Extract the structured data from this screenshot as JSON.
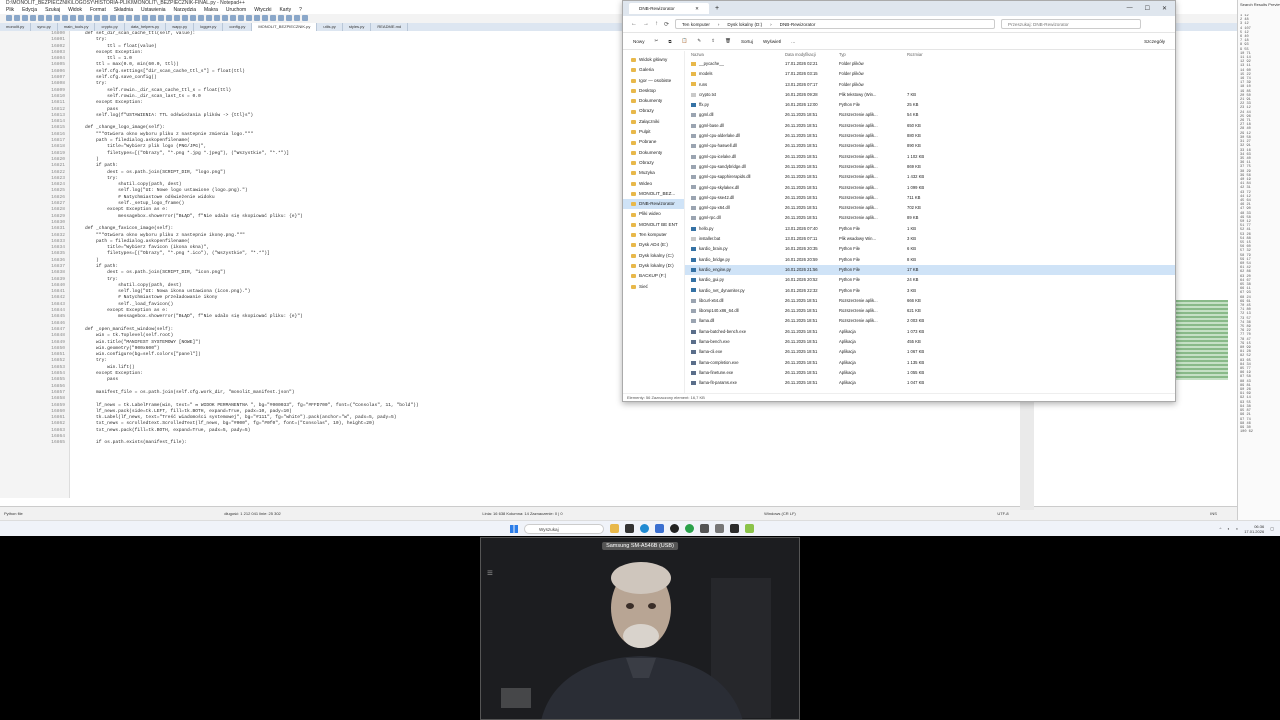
{
  "editor": {
    "title": "D:\\MONOLIT_BEZPIECZNIK\\LOGOSY\\HISTORIA-PLIKI\\MONOLIT\\_BEZPIECZNIK-FINAL.py - Notepad++",
    "menu": [
      "Plik",
      "Edycja",
      "Szukaj",
      "Widok",
      "Format",
      "Składnia",
      "Ustawienia",
      "Narzędzia",
      "Makra",
      "Uruchom",
      "Wtyczki",
      "Karty",
      "?"
    ],
    "tabs": [
      "monolit.py",
      "sync.py",
      "main_tools.py",
      "crypto.py",
      "data_helpers.py",
      "wapp.py",
      "logger.py",
      "config.py",
      "MONOLIT_BEZPIECZNIK.py",
      "utils.py",
      "styles.py",
      "README.md"
    ],
    "active_tab_index": 8,
    "line_start": 16800,
    "code_lines": [
      "    def set_dir_scan_cache_ttl(self, value):",
      "        try:",
      "            ttl = float(value)",
      "        except Exception:",
      "            ttl = 1.0",
      "        ttl = max(0.0, min(60.0, ttl))",
      "        self.cfg.settings[\"dir_scan_cache_ttl_s\"] = float(ttl)",
      "        self.cfg.save_config()",
      "        try:",
      "            self.rowin._dir_scan_cache_ttl_s = float(ttl)",
      "            self.rowin._dir_scan_last_ts = 0.0",
      "        except Exception:",
      "            pass",
      "        self.log(f\"USTAWIENIA: TTL odświeżania plików -> {ttl}s\")",
      "",
      "    def _change_logo_image(self):",
      "        \"\"\"Otwiera okno wyboru pliku z nastepnie zmienia logo.\"\"\"",
      "        path = filedialog.askopenfilename(",
      "            title=\"Wybierz plik logo (PNG/JPG)\",",
      "            filetypes=[(\"Obrazy\", \"*.png *.jpg *.jpeg\"), (\"Wszystkie\", \"*.*\")]",
      "        )",
      "        if path:",
      "            dest = os.path.join(SCRIPT_DIR, \"logo.png\")",
      "            try:",
      "                shutil.copy(path, dest)",
      "                self.log(\"UI: Nowe logo ustawione (logo.png).\")",
      "                # Natychmiastowe odświeżenie widoku",
      "                self._setup_logo_frame()",
      "            except Exception as e:",
      "                messagebox.showerror(\"BŁĄD\", f\"Nie udało się skopiować pliku: {e}\")",
      "",
      "    def _change_favicon_image(self):",
      "        \"\"\"Otwiera okno wyboru pliku z nastepnie ikonę.png.\"\"\"",
      "        path = filedialog.askopenfilename(",
      "            title=\"Wybierz favicon (ikona okna)\",",
      "            filetypes=[(\"Obrazy\", \"*.png *.ico\"), (\"Wszystkie\", \"*.*\")]",
      "        )",
      "        if path:",
      "            dest = os.path.join(SCRIPT_DIR, \"icon.png\")",
      "            try:",
      "                shutil.copy(path, dest)",
      "                self.log(\"UI: Nowa ikona ustawiona (icon.png).\")",
      "                # Natychmiastowe przeładowanie ikony",
      "                self._load_favicon()",
      "            except Exception as e:",
      "                messagebox.showerror(\"BŁĄD\", f\"Nie udało się skopiować pliku: {e}\")",
      "",
      "    def _open_manifest_window(self):",
      "        win = tk.Toplevel(self.root)",
      "        win.title(\"MANIFEST SYSTEMOWY [NOWE]\")",
      "        win.geometry(\"900x600\")",
      "        win.configure(bg=self.colors[\"panel\"])",
      "        try:",
      "            win.lift()",
      "        except Exception:",
      "            pass",
      "",
      "        manifest_file = os.path.join(self.cfg.work_dir, \"monolit_manifest.json\")",
      "",
      "        lf_news = tk.LabelFrame(win, text=\" ✉ WIDOK PERMANENTNA \", bg=\"#000033\", fg=\"#FFD700\", font=(\"Consolas\", 11, \"bold\"))",
      "        lf_news.pack(side=tk.LEFT, fill=tk.BOTH, expand=True, padx=10, pady=10)",
      "        tk.Label(lf_news, text=\"Treść wiadomości systemowej\", bg=\"#111\", fg=\"white\").pack(anchor=\"w\", padx=5, pady=5)",
      "        txt_news = scrolledtext.ScrolledText(lf_news, bg=\"#000\", fg=\"#0f0\", font=(\"Consolas\", 10), height=20)",
      "        txt_news.pack(fill=tk.BOTH, expand=True, padx=5, pady=5)",
      "",
      "        if os.path.exists(manifest_file):"
    ],
    "status": {
      "file_type": "Python file",
      "length": "długość: 1 212 041   linie: 25 302",
      "position": "Linia: 16 638   Kolumna: 14   Zaznaczenie: 0 | 0",
      "eol": "Windows (CR LF)",
      "encoding": "UTF-8",
      "mode": "INS"
    }
  },
  "side_panel": {
    "title": "Search Results Preview",
    "lines": [
      "1 12",
      "2 48",
      "3 12",
      "4 107",
      "5 12",
      "6 40",
      "7 18",
      "8 93",
      "9 55",
      "10 71",
      "11 14",
      "12 92",
      "13 11",
      "14 60",
      "15 22",
      "16 74",
      "17 39",
      "18 10",
      "19 85",
      "20 50",
      "21 91",
      "22 33",
      "23 12",
      "24 44",
      "25 96",
      "26 71",
      "27 18",
      "28 40",
      "29 12",
      "30 58",
      "31 27",
      "32 91",
      "33 16",
      "34 63",
      "35 40",
      "36 11",
      "37 75",
      "38 29",
      "39 56",
      "40 19",
      "41 84",
      "42 31",
      "43 72",
      "44 12",
      "45 64",
      "46 21",
      "47 90",
      "48 33",
      "49 58",
      "50 12",
      "51 77",
      "52 41",
      "53 26",
      "54 88",
      "55 15",
      "56 60",
      "57 32",
      "58 79",
      "59 17",
      "60 54",
      "61 42",
      "62 86",
      "63 20",
      "64 67",
      "65 38",
      "66 11",
      "67 93",
      "68 24",
      "69 61",
      "70 45",
      "71 80",
      "72 13",
      "73 57",
      "74 36",
      "75 89",
      "76 22",
      "77 70",
      "78 47",
      "79 15",
      "80 99",
      "81 28",
      "82 52",
      "83 65",
      "84 34",
      "85 77",
      "86 19",
      "87 58",
      "88 43",
      "89 81",
      "90 26",
      "91 69",
      "92 14",
      "93 55",
      "94 38",
      "95 87",
      "96 21",
      "97 74",
      "98 46",
      "99 30",
      "100 62"
    ]
  },
  "explorer": {
    "tab_title": "DNB-Rewizorator",
    "address": [
      "Ten komputer",
      "Dysk lokalny (D:)",
      "DNB-Rewizorator"
    ],
    "search_placeholder": "Przeszukaj: DNB-Rewizorator",
    "commands": [
      "Nowy",
      "Sortuj",
      "Wyświetl",
      "Szczegóły"
    ],
    "columns": [
      "Nazwa",
      "Data modyfikacji",
      "Typ",
      "Rozmiar"
    ],
    "nav": [
      {
        "label": "Widok główny"
      },
      {
        "label": "Galeria"
      },
      {
        "label": "Igor — osobiste"
      },
      {
        "label": "Desktop"
      },
      {
        "label": "Dokumenty"
      },
      {
        "label": "Obrazy"
      },
      {
        "label": "Załączniki"
      },
      {
        "label": "Pulpit"
      },
      {
        "label": "Pobrane"
      },
      {
        "label": "Dokumenty"
      },
      {
        "label": "Obrazy"
      },
      {
        "label": "Muzyka"
      },
      {
        "label": "Wideo"
      },
      {
        "label": "MONOLIT_BEZ..."
      },
      {
        "label": "DNB-Rewizorator",
        "selected": true
      },
      {
        "label": "Pliki wideo"
      },
      {
        "label": "MONOLIT BE ENT"
      },
      {
        "label": "Ten komputer"
      },
      {
        "label": "Dysk AD4 (E:)"
      },
      {
        "label": "Dysk lokalny (C:)"
      },
      {
        "label": "Dysk lokalny (D:)"
      },
      {
        "label": "BACKUP (F:)"
      },
      {
        "label": "Sieć"
      }
    ],
    "files": [
      {
        "name": "__pycache__",
        "date": "17.01.2026 02:21",
        "type": "Folder plików",
        "size": ""
      },
      {
        "name": "models",
        "date": "17.01.2026 03:15",
        "type": "Folder plików",
        "size": ""
      },
      {
        "name": "runs",
        "date": "13.01.2026 07:17",
        "type": "Folder plików",
        "size": ""
      },
      {
        "name": "crypto.txt",
        "date": "16.01.2026 09:28",
        "type": "Plik tekstowy (Win...",
        "size": "7 KB"
      },
      {
        "name": "ffx.py",
        "date": "16.01.2026 12:00",
        "type": "Python File",
        "size": "25 KB"
      },
      {
        "name": "ggml.dll",
        "date": "26.11.2025 18:51",
        "type": "Rozszerzenie aplik...",
        "size": "54 KB"
      },
      {
        "name": "ggml-base.dll",
        "date": "26.11.2025 18:51",
        "type": "Rozszerzenie aplik...",
        "size": "650 KB"
      },
      {
        "name": "ggml-cpu-alderlake.dll",
        "date": "26.11.2025 18:51",
        "type": "Rozszerzenie aplik...",
        "size": "880 KB"
      },
      {
        "name": "ggml-cpu-haswell.dll",
        "date": "26.11.2025 18:51",
        "type": "Rozszerzenie aplik...",
        "size": "890 KB"
      },
      {
        "name": "ggml-cpu-icelake.dll",
        "date": "26.11.2025 18:51",
        "type": "Rozszerzenie aplik...",
        "size": "1 102 KB"
      },
      {
        "name": "ggml-cpu-sandybridge.dll",
        "date": "26.11.2025 18:51",
        "type": "Rozszerzenie aplik...",
        "size": "869 KB"
      },
      {
        "name": "ggml-cpu-sapphirerapids.dll",
        "date": "26.11.2025 18:51",
        "type": "Rozszerzenie aplik...",
        "size": "1 432 KB"
      },
      {
        "name": "ggml-cpu-skylakex.dll",
        "date": "26.11.2025 18:51",
        "type": "Rozszerzenie aplik...",
        "size": "1 099 KB"
      },
      {
        "name": "ggml-cpu-sse42.dll",
        "date": "26.11.2025 18:51",
        "type": "Rozszerzenie aplik...",
        "size": "711 KB"
      },
      {
        "name": "ggml-cpu-x64.dll",
        "date": "26.11.2025 18:51",
        "type": "Rozszerzenie aplik...",
        "size": "702 KB"
      },
      {
        "name": "ggml-rpc.dll",
        "date": "26.11.2025 18:51",
        "type": "Rozszerzenie aplik...",
        "size": "89 KB"
      },
      {
        "name": "hello.py",
        "date": "13.01.2026 07:40",
        "type": "Python File",
        "size": "1 KB"
      },
      {
        "name": "installer.bat",
        "date": "13.01.2026 07:11",
        "type": "Plik wsadowy Win...",
        "size": "3 KB"
      },
      {
        "name": "kardio_brain.py",
        "date": "16.01.2026 20:35",
        "type": "Python File",
        "size": "6 KB"
      },
      {
        "name": "kardio_bridge.py",
        "date": "16.01.2026 20:59",
        "type": "Python File",
        "size": "8 KB"
      },
      {
        "name": "kardio_engine.py",
        "date": "16.01.2026 21:56",
        "type": "Python File",
        "size": "17 KB",
        "selected": true
      },
      {
        "name": "kardio_gui.py",
        "date": "16.01.2026 20:52",
        "type": "Python File",
        "size": "24 KB"
      },
      {
        "name": "kardio_net_dynamiter.py",
        "date": "16.01.2026 22:32",
        "type": "Python File",
        "size": "3 KB"
      },
      {
        "name": "libcurl-x64.dll",
        "date": "26.11.2025 18:51",
        "type": "Rozszerzenie aplik...",
        "size": "666 KB"
      },
      {
        "name": "libomp140.x86_64.dll",
        "date": "26.11.2025 18:51",
        "type": "Rozszerzenie aplik...",
        "size": "621 KB"
      },
      {
        "name": "llama.dll",
        "date": "26.11.2025 18:51",
        "type": "Rozszerzenie aplik...",
        "size": "2 003 KB"
      },
      {
        "name": "llama-batched-bench.exe",
        "date": "26.11.2025 18:51",
        "type": "Aplikacja",
        "size": "1 073 KB"
      },
      {
        "name": "llama-bench.exe",
        "date": "26.11.2025 18:51",
        "type": "Aplikacja",
        "size": "455 KB"
      },
      {
        "name": "llama-cli.exe",
        "date": "26.11.2025 18:51",
        "type": "Aplikacja",
        "size": "1 067 KB"
      },
      {
        "name": "llama-completion.exe",
        "date": "26.11.2025 18:51",
        "type": "Aplikacja",
        "size": "1 135 KB"
      },
      {
        "name": "llama-finetune.exe",
        "date": "26.11.2025 18:51",
        "type": "Aplikacja",
        "size": "1 055 KB"
      },
      {
        "name": "llama-fit-params.exe",
        "date": "26.11.2025 18:51",
        "type": "Aplikacja",
        "size": "1 047 KB"
      }
    ],
    "footer": "Elementy: 56    Zaznaczony element: 16,7 KB"
  },
  "taskbar": {
    "search": "Wyszukaj",
    "time": "06:36",
    "date": "17.01.2026"
  },
  "webcam": {
    "label": "Samsung SM-A546B (USB)"
  }
}
